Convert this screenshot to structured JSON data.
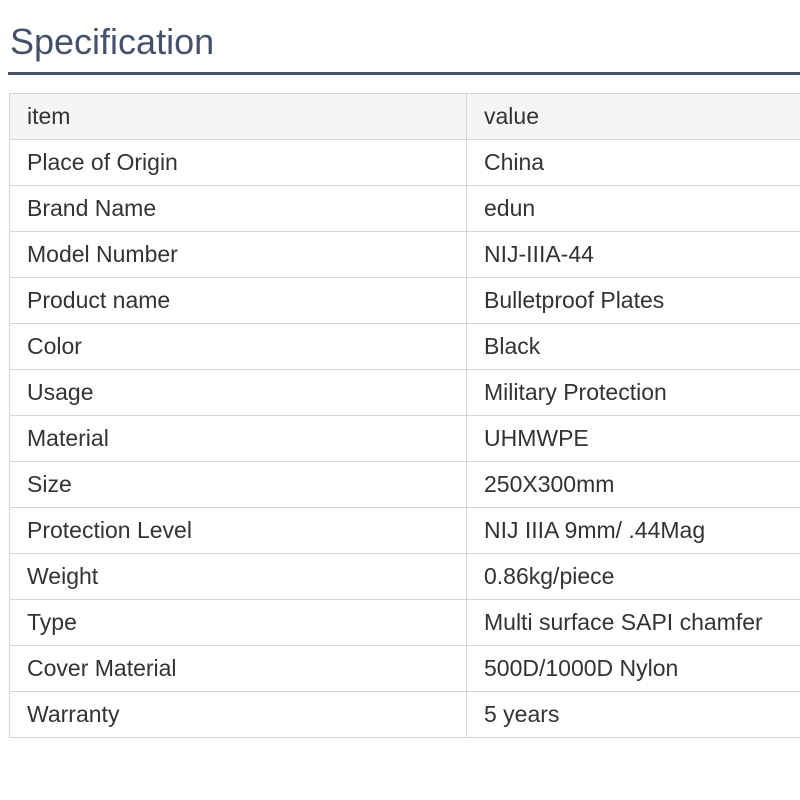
{
  "page": {
    "title": "Specification"
  },
  "colors": {
    "title": "#45516b",
    "rule": "#45516b",
    "text": "#333333",
    "border": "#d6d6d6",
    "header_bg": "#f5f5f5"
  },
  "table": {
    "headers": [
      "item",
      "value"
    ],
    "rows": [
      [
        "Place of Origin",
        "China"
      ],
      [
        "Brand Name",
        "edun"
      ],
      [
        "Model Number",
        "NIJ-IIIA-44"
      ],
      [
        "Product name",
        "Bulletproof Plates"
      ],
      [
        "Color",
        "Black"
      ],
      [
        "Usage",
        "Military Protection"
      ],
      [
        "Material",
        "UHMWPE"
      ],
      [
        "Size",
        "250X300mm"
      ],
      [
        "Protection Level",
        "NIJ IIIA 9mm/ .44Mag"
      ],
      [
        "Weight",
        "0.86kg/piece"
      ],
      [
        "Type",
        "Multi surface SAPI chamfer"
      ],
      [
        "Cover Material",
        "500D/1000D Nylon"
      ],
      [
        "Warranty",
        "5 years"
      ]
    ]
  }
}
